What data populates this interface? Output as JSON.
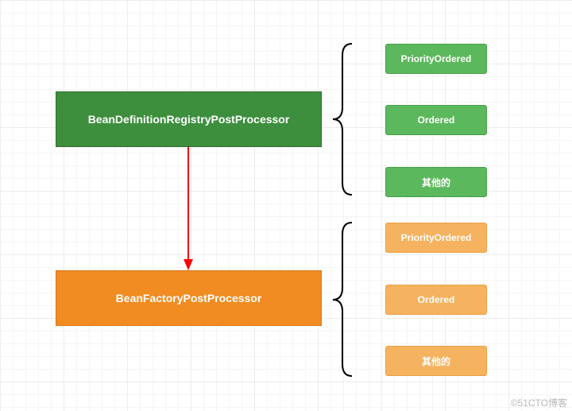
{
  "diagram": {
    "main_green": "BeanDefinitionRegistryPostProcessor",
    "main_orange": "BeanFactoryPostProcessor",
    "green_children": {
      "priority": "PriorityOrdered",
      "ordered": "Ordered",
      "other": "其他的"
    },
    "orange_children": {
      "priority": "PriorityOrdered",
      "ordered": "Ordered",
      "other": "其他的"
    }
  },
  "colors": {
    "green_dark": "#3d8e3d",
    "green_light": "#5cb85c",
    "orange_dark": "#f08c22",
    "orange_light": "#f5b25f",
    "arrow": "#ff0000"
  },
  "watermark": "©51CTO博客"
}
